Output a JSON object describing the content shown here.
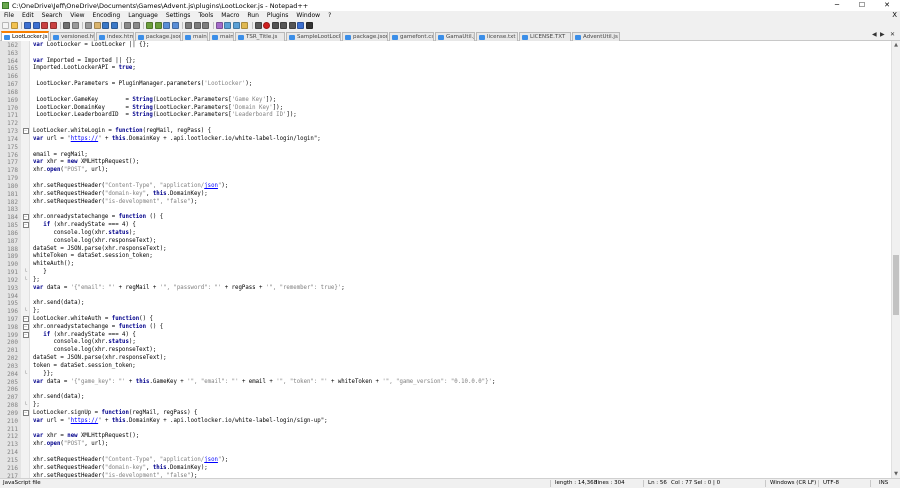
{
  "window": {
    "title": "C:\\OneDrive\\Jeff\\OneDrive\\Documents\\Games\\Advent.js\\plugins\\LootLocker.js - Notepad++",
    "minimize": "─",
    "maximize": "☐",
    "close": "✕"
  },
  "menu": {
    "items": [
      "File",
      "Edit",
      "Search",
      "View",
      "Encoding",
      "Language",
      "Settings",
      "Tools",
      "Macro",
      "Run",
      "Plugins",
      "Window",
      "?"
    ],
    "close_x": "X"
  },
  "toolbar": {
    "icons": [
      "new-file-icon",
      "open-file-icon",
      "save-icon",
      "save-all-icon",
      "close-icon",
      "close-all-icon",
      "print-icon",
      "cut-icon",
      "copy-icon",
      "paste-icon",
      "undo-icon",
      "redo-icon",
      "find-icon",
      "replace-icon",
      "zoom-in-icon",
      "zoom-out-icon",
      "sync-v-icon",
      "sync-h-icon",
      "word-wrap-icon",
      "all-chars-icon",
      "indent-guide-icon",
      "udl-icon",
      "doc-map-icon",
      "function-list-icon",
      "folder-workspace-icon",
      "monitor-icon",
      "record-icon",
      "stop-icon",
      "play-icon",
      "play-multi-icon",
      "save-macro-icon",
      "abc-spellcheck-icon"
    ]
  },
  "tabs": [
    {
      "label": "LootLocker.js",
      "active": true
    },
    {
      "label": "versioned.html",
      "active": false
    },
    {
      "label": "index.html",
      "active": false
    },
    {
      "label": "package.json",
      "active": false
    },
    {
      "label": "main.js",
      "active": false
    },
    {
      "label": "main.js",
      "active": false
    },
    {
      "label": "TSR_Title.js",
      "active": false
    },
    {
      "label": "SampleLootLocker.js",
      "active": false
    },
    {
      "label": "package.json",
      "active": false
    },
    {
      "label": "gamefont.css",
      "active": false
    },
    {
      "label": "GamaUtil.js",
      "active": false
    },
    {
      "label": "license.txt",
      "active": false
    },
    {
      "label": "LICENSE.TXT",
      "active": false
    },
    {
      "label": "AdventUtil.js",
      "active": false
    }
  ],
  "tab_nav": {
    "left": "◀",
    "right": "▶",
    "close": "✕"
  },
  "editor": {
    "lines": [
      {
        "n": "162",
        "f": "",
        "c": [
          [
            "kw",
            "var"
          ],
          [
            "t",
            " LootLocker = LootLocker || {};"
          ]
        ]
      },
      {
        "n": "163",
        "f": "",
        "c": []
      },
      {
        "n": "164",
        "f": "",
        "c": [
          [
            "kw",
            "var"
          ],
          [
            "t",
            " Imported = Imported || {};"
          ]
        ]
      },
      {
        "n": "165",
        "f": "",
        "c": [
          [
            "t",
            "Imported.LootLockerAPI = "
          ],
          [
            "kw",
            "true"
          ],
          [
            "t",
            ";"
          ]
        ]
      },
      {
        "n": "166",
        "f": "",
        "c": []
      },
      {
        "n": "167",
        "f": "",
        "c": [
          [
            "t",
            " LootLocker.Parameters = PluginManager.parameters("
          ],
          [
            "str",
            "'LootLocker'"
          ],
          [
            "t",
            ");"
          ]
        ]
      },
      {
        "n": "168",
        "f": "",
        "c": []
      },
      {
        "n": "169",
        "f": "",
        "c": [
          [
            "t",
            " LootLocker.GameKey        = "
          ],
          [
            "kw",
            "String"
          ],
          [
            "t",
            "(LootLocker.Parameters["
          ],
          [
            "str",
            "'Game Key'"
          ],
          [
            "t",
            "]);"
          ]
        ]
      },
      {
        "n": "170",
        "f": "",
        "c": [
          [
            "t",
            " LootLocker.DomainKey      = "
          ],
          [
            "kw",
            "String"
          ],
          [
            "t",
            "(LootLocker.Parameters["
          ],
          [
            "str",
            "'Domain Key'"
          ],
          [
            "t",
            "]);"
          ]
        ]
      },
      {
        "n": "171",
        "f": "",
        "c": [
          [
            "t",
            " LootLocker.LeaderboardID  = "
          ],
          [
            "kw",
            "String"
          ],
          [
            "t",
            "(LootLocker.Parameters["
          ],
          [
            "str",
            "'Leaderboard ID'"
          ],
          [
            "t",
            "]);"
          ]
        ]
      },
      {
        "n": "172",
        "f": "",
        "c": []
      },
      {
        "n": "173",
        "f": "open",
        "c": [
          [
            "t",
            "LootLocker.whiteLogin = "
          ],
          [
            "kw",
            "function"
          ],
          [
            "t",
            "(regMail, regPass) {"
          ]
        ]
      },
      {
        "n": "174",
        "f": "",
        "c": [
          [
            "kw",
            "var"
          ],
          [
            "t",
            " url = "
          ],
          [
            "str",
            "\""
          ],
          [
            "url",
            "https://"
          ],
          [
            "str",
            "\""
          ],
          [
            "t",
            " + "
          ],
          [
            "kw",
            "this"
          ],
          [
            "t",
            ".DomainKey + .api.lootlocker.io/white-label-login/login\";"
          ]
        ]
      },
      {
        "n": "175",
        "f": "",
        "c": []
      },
      {
        "n": "176",
        "f": "",
        "c": [
          [
            "t",
            "email = regMail;"
          ]
        ]
      },
      {
        "n": "177",
        "f": "",
        "c": [
          [
            "kw",
            "var"
          ],
          [
            "t",
            " xhr = "
          ],
          [
            "kw",
            "new"
          ],
          [
            "t",
            " XMLHttpRequest();"
          ]
        ]
      },
      {
        "n": "178",
        "f": "",
        "c": [
          [
            "t",
            "xhr."
          ],
          [
            "kw",
            "open"
          ],
          [
            "t",
            "("
          ],
          [
            "str",
            "\"POST\""
          ],
          [
            "t",
            ", url);"
          ]
        ]
      },
      {
        "n": "179",
        "f": "",
        "c": []
      },
      {
        "n": "180",
        "f": "",
        "c": [
          [
            "t",
            "xhr.setRequestHeader("
          ],
          [
            "str",
            "\"Content-Type\", \"application/"
          ],
          [
            "url",
            "json"
          ],
          [
            "str",
            "\""
          ],
          [
            "t",
            ");"
          ]
        ]
      },
      {
        "n": "181",
        "f": "",
        "c": [
          [
            "t",
            "xhr.setRequestHeader("
          ],
          [
            "str",
            "\"domain-key\""
          ],
          [
            "t",
            ", "
          ],
          [
            "kw",
            "this"
          ],
          [
            "t",
            ".DomainKey);"
          ]
        ]
      },
      {
        "n": "182",
        "f": "",
        "c": [
          [
            "t",
            "xhr.setRequestHeader("
          ],
          [
            "str",
            "\"is-development\", \"false\""
          ],
          [
            "t",
            ");"
          ]
        ]
      },
      {
        "n": "183",
        "f": "",
        "c": []
      },
      {
        "n": "184",
        "f": "open",
        "c": [
          [
            "t",
            "xhr.onreadystatechange = "
          ],
          [
            "kw",
            "function"
          ],
          [
            "t",
            " () {"
          ]
        ]
      },
      {
        "n": "185",
        "f": "open",
        "c": [
          [
            "t",
            "   "
          ],
          [
            "kw",
            "if"
          ],
          [
            "t",
            " (xhr.readyState === 4) {"
          ]
        ]
      },
      {
        "n": "186",
        "f": "",
        "c": [
          [
            "t",
            "      console.log(xhr."
          ],
          [
            "kw",
            "status"
          ],
          [
            "t",
            ");"
          ]
        ]
      },
      {
        "n": "187",
        "f": "",
        "c": [
          [
            "t",
            "      console.log(xhr.responseText);"
          ]
        ]
      },
      {
        "n": "188",
        "f": "",
        "c": [
          [
            "t",
            "dataSet = JSON.parse(xhr.responseText);"
          ]
        ]
      },
      {
        "n": "189",
        "f": "",
        "c": [
          [
            "t",
            "whiteToken = dataSet.session_token;"
          ]
        ]
      },
      {
        "n": "190",
        "f": "",
        "c": [
          [
            "t",
            "whiteAuth();"
          ]
        ]
      },
      {
        "n": "191",
        "f": "end",
        "c": [
          [
            "t",
            "   }"
          ]
        ]
      },
      {
        "n": "192",
        "f": "end",
        "c": [
          [
            "t",
            "};"
          ]
        ]
      },
      {
        "n": "193",
        "f": "",
        "c": [
          [
            "kw",
            "var"
          ],
          [
            "t",
            " data = "
          ],
          [
            "str",
            "'{\"email\": \"'"
          ],
          [
            "t",
            " + regMail + "
          ],
          [
            "str",
            "'\", \"password\": \"'"
          ],
          [
            "t",
            " + regPass + "
          ],
          [
            "str",
            "'\", \"remember\": true}'"
          ],
          [
            "t",
            ";"
          ]
        ]
      },
      {
        "n": "194",
        "f": "",
        "c": []
      },
      {
        "n": "195",
        "f": "",
        "c": [
          [
            "t",
            "xhr.send(data);"
          ]
        ]
      },
      {
        "n": "196",
        "f": "end",
        "c": [
          [
            "t",
            "};"
          ]
        ]
      },
      {
        "n": "197",
        "f": "open",
        "c": [
          [
            "t",
            "LootLocker.whiteAuth = "
          ],
          [
            "kw",
            "function"
          ],
          [
            "t",
            "() {"
          ]
        ]
      },
      {
        "n": "198",
        "f": "open",
        "c": [
          [
            "t",
            "xhr.onreadystatechange = "
          ],
          [
            "kw",
            "function"
          ],
          [
            "t",
            " () {"
          ]
        ]
      },
      {
        "n": "199",
        "f": "open",
        "c": [
          [
            "t",
            "   "
          ],
          [
            "kw",
            "if"
          ],
          [
            "t",
            " (xhr.readyState === 4) {"
          ]
        ]
      },
      {
        "n": "200",
        "f": "",
        "c": [
          [
            "t",
            "      console.log(xhr."
          ],
          [
            "kw",
            "status"
          ],
          [
            "t",
            ");"
          ]
        ]
      },
      {
        "n": "201",
        "f": "",
        "c": [
          [
            "t",
            "      console.log(xhr.responseText);"
          ]
        ]
      },
      {
        "n": "202",
        "f": "",
        "c": [
          [
            "t",
            "dataSet = JSON.parse(xhr.responseText);"
          ]
        ]
      },
      {
        "n": "203",
        "f": "",
        "c": [
          [
            "t",
            "token = dataSet.session_token;"
          ]
        ]
      },
      {
        "n": "204",
        "f": "end",
        "c": [
          [
            "t",
            "   }};"
          ]
        ]
      },
      {
        "n": "205",
        "f": "",
        "c": [
          [
            "kw",
            "var"
          ],
          [
            "t",
            " data = "
          ],
          [
            "str",
            "'{\"game_key\": \"'"
          ],
          [
            "t",
            " + "
          ],
          [
            "kw",
            "this"
          ],
          [
            "t",
            ".GameKey + "
          ],
          [
            "str",
            "'\", \"email\": \"'"
          ],
          [
            "t",
            " + email + "
          ],
          [
            "str",
            "'\", \"token\": \"'"
          ],
          [
            "t",
            " + whiteToken + "
          ],
          [
            "str",
            "'\", \"game_version\": \"0.10.0.0\"}'"
          ],
          [
            "t",
            ";"
          ]
        ]
      },
      {
        "n": "206",
        "f": "",
        "c": []
      },
      {
        "n": "207",
        "f": "",
        "c": [
          [
            "t",
            "xhr.send(data);"
          ]
        ]
      },
      {
        "n": "208",
        "f": "end",
        "c": [
          [
            "t",
            "};"
          ]
        ]
      },
      {
        "n": "209",
        "f": "open",
        "c": [
          [
            "t",
            "LootLocker.signUp = "
          ],
          [
            "kw",
            "function"
          ],
          [
            "t",
            "(regMail, regPass) {"
          ]
        ]
      },
      {
        "n": "210",
        "f": "",
        "c": [
          [
            "kw",
            "var"
          ],
          [
            "t",
            " url = "
          ],
          [
            "str",
            "\""
          ],
          [
            "url",
            "https://"
          ],
          [
            "str",
            "\""
          ],
          [
            "t",
            " + "
          ],
          [
            "kw",
            "this"
          ],
          [
            "t",
            ".DomainKey + .api.lootlocker.io/white-label-login/sign-up\";"
          ]
        ]
      },
      {
        "n": "211",
        "f": "",
        "c": []
      },
      {
        "n": "212",
        "f": "",
        "c": [
          [
            "kw",
            "var"
          ],
          [
            "t",
            " xhr = "
          ],
          [
            "kw",
            "new"
          ],
          [
            "t",
            " XMLHttpRequest();"
          ]
        ]
      },
      {
        "n": "213",
        "f": "",
        "c": [
          [
            "t",
            "xhr."
          ],
          [
            "kw",
            "open"
          ],
          [
            "t",
            "("
          ],
          [
            "str",
            "\"POST\""
          ],
          [
            "t",
            ", url);"
          ]
        ]
      },
      {
        "n": "214",
        "f": "",
        "c": []
      },
      {
        "n": "215",
        "f": "",
        "c": [
          [
            "t",
            "xhr.setRequestHeader("
          ],
          [
            "str",
            "\"Content-Type\", \"application/"
          ],
          [
            "url",
            "json"
          ],
          [
            "str",
            "\""
          ],
          [
            "t",
            ");"
          ]
        ]
      },
      {
        "n": "216",
        "f": "",
        "c": [
          [
            "t",
            "xhr.setRequestHeader("
          ],
          [
            "str",
            "\"domain-key\""
          ],
          [
            "t",
            ", "
          ],
          [
            "kw",
            "this"
          ],
          [
            "t",
            ".DomainKey);"
          ]
        ]
      },
      {
        "n": "217",
        "f": "",
        "c": [
          [
            "t",
            "xhr.setRequestHeader("
          ],
          [
            "str",
            "\"is-development\", \"false\""
          ],
          [
            "t",
            ");"
          ]
        ]
      }
    ]
  },
  "scrollbar": {
    "up": "▲",
    "down": "▼",
    "position_fraction": 0.57
  },
  "status": {
    "file_type": "JavaScript file",
    "length": "length : 14,368",
    "lines": "lines : 304",
    "ln": "Ln : 56",
    "col": "Col : 77",
    "sel": "Sel : 0 | 0",
    "eol": "Windows (CR LF)",
    "encoding": "UTF-8",
    "mode": "INS"
  },
  "colors": {
    "keyword": "#00008b",
    "string": "#808080",
    "url": "#0000ff",
    "active_tab_accent": "#fa8000"
  }
}
